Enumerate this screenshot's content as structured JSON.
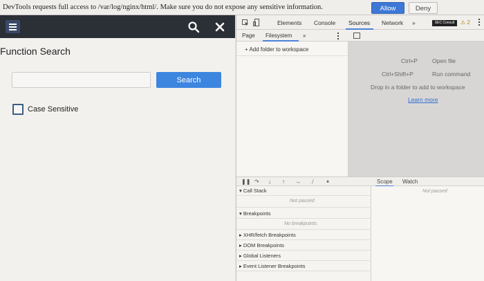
{
  "infobar": {
    "message": "DevTools requests full access to /var/log/nginx/html/. Make sure you do not expose any sensitive information.",
    "allow_label": "Allow",
    "deny_label": "Deny"
  },
  "app": {
    "title": "Function Search",
    "search_placeholder": "",
    "search_button": "Search",
    "case_sensitive_label": "Case Sensitive",
    "icons": [
      "menu-icon",
      "search-icon",
      "close-icon"
    ]
  },
  "devtools": {
    "tabs": [
      "Elements",
      "Console",
      "Sources",
      "Network",
      "»"
    ],
    "active_tab": "Sources",
    "badge": "SEC Consult",
    "warning_count": "2",
    "navigator": {
      "tabs": [
        "Page",
        "Filesystem",
        "»"
      ],
      "active_tab": "Filesystem",
      "add_folder": "+ Add folder to workspace"
    },
    "editor_hints": {
      "shortcut1": "Ctrl+P",
      "action1": "Open file",
      "shortcut2": "Ctrl+Shift+P",
      "action2": "Run command",
      "drop": "Drop in a folder to add to workspace",
      "learn_more": "Learn more"
    },
    "debugger": {
      "call_stack": "Call Stack",
      "not_paused": "Not paused",
      "breakpoints": "Breakpoints",
      "no_breakpoints": "No breakpoints",
      "xhr": "XHR/fetch Breakpoints",
      "dom": "DOM Breakpoints",
      "global": "Global Listeners",
      "event": "Event Listener Breakpoints"
    },
    "scope": {
      "tabs": [
        "Scope",
        "Watch"
      ],
      "active_tab": "Scope",
      "not_paused": "Not paused"
    }
  },
  "colors": {
    "allow_button": "#3d78d6",
    "search_button": "#3d86df",
    "appbar": "#2b2f36",
    "tab_underline": "#4b82d8"
  }
}
